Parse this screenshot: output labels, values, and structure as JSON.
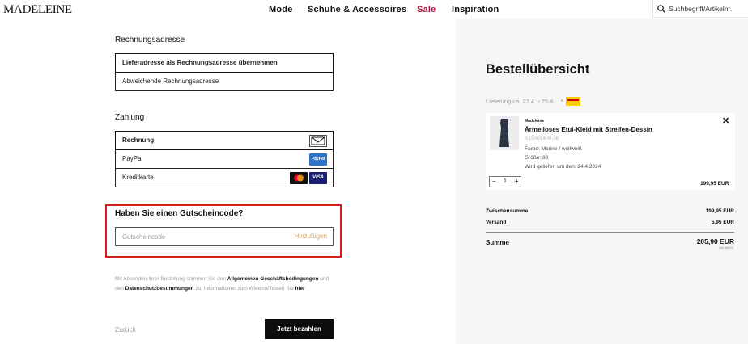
{
  "header": {
    "logo": "MADELEINE",
    "nav": [
      "Mode",
      "Schuhe & Accessoires",
      "Sale",
      "Inspiration"
    ],
    "search_placeholder": "Suchbegriff/Artikelnr."
  },
  "billing": {
    "title": "Rechnungsadresse",
    "options": [
      "Lieferadresse als Rechnungsadresse übernehmen",
      "Abweichende Rechnungsadresse"
    ],
    "selected": "Lieferadresse als Rechnungsadresse übernehmen"
  },
  "payment": {
    "title": "Zahlung",
    "options": [
      "Rechnung",
      "PayPal",
      "Kreditkarte"
    ],
    "selected": "Rechnung",
    "badges": {
      "paypal": "PayPal",
      "visa": "VISA"
    }
  },
  "voucher": {
    "title": "Haben Sie einen Gutscheincode?",
    "placeholder": "Gutscheincode",
    "add_label": "Hinzufügen"
  },
  "legal": {
    "t1": "Mit Absenden Ihrer Bestellung stimmen Sie den ",
    "link1": "Allgemeinen Geschäftsbedingungen",
    "t2": " und den ",
    "link2": "Datenschutzbestimmungen",
    "t3": " zu. Informationen zum Widerruf finden Sie ",
    "link3": "hier",
    "t4": "."
  },
  "actions": {
    "back": "Zurück",
    "pay": "Jetzt bezahlen"
  },
  "summary": {
    "title": "Bestellübersicht",
    "delivery": "Lieferung ca. 22.4. - 25.4.",
    "bullet": "•",
    "item": {
      "brand": "Madeleine",
      "name": "Ärmelloses Etui-Kleid mit Streifen-Dessin",
      "sku": "A150014-N-38",
      "color": "Farbe: Marine / wollweiß",
      "size": "Größe: 38",
      "delivery_date": "Wird geliefert um den: 24.4.2024",
      "quantity": "1",
      "minus": "−",
      "plus": "+",
      "price": "199,95 EUR"
    },
    "subtotal_label": "Zwischensumme",
    "subtotal": "199,95 EUR",
    "shipping_label": "Versand",
    "shipping": "5,95 EUR",
    "total_label": "Summe",
    "total": "205,90 EUR",
    "vat_note": "inkl. MwSt."
  },
  "colors": {
    "sale": "#b5123f",
    "highlight": "#d41e1e",
    "accent_link": "#c9a36a",
    "panel_bg": "#f6f6f6"
  }
}
